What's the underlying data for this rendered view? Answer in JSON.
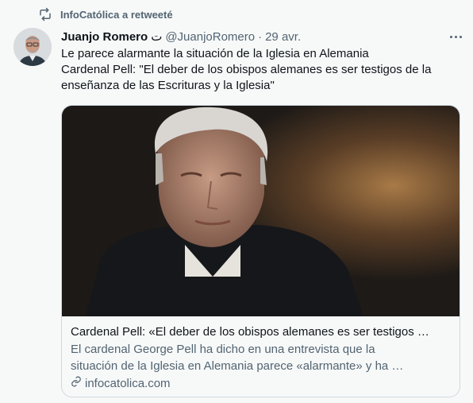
{
  "retweet": {
    "icon": "retweet-icon",
    "text": "InfoCatólica a retweeté"
  },
  "tweet": {
    "author_name": "Juanjo Romero",
    "author_badge": "ت",
    "handle": "@JuanjoRomero",
    "separator": "·",
    "date": "29 avr.",
    "more_icon": "more-horizontal-icon",
    "text_lines": [
      "Le parece alarmante la situación de la Iglesia en Alemania",
      "Cardenal Pell: \"El deber de los obispos alemanes es ser testigos de la",
      "enseñanza de las Escrituras y la Iglesia\""
    ]
  },
  "card": {
    "image_icon": "article-photo",
    "title": "Cardenal Pell: «El deber de los obispos alemanes es ser testigos …",
    "description_lines": [
      "El cardenal George Pell ha dicho en una entrevista que la",
      "situación de la Iglesia en Alemania parece «alarmante» y ha …"
    ],
    "link_icon": "link-icon",
    "domain": "infocatolica.com"
  },
  "colors": {
    "background": "#f7f9f9",
    "primary_text": "#0f1419",
    "secondary_text": "#536471",
    "border": "#cfd9de"
  }
}
